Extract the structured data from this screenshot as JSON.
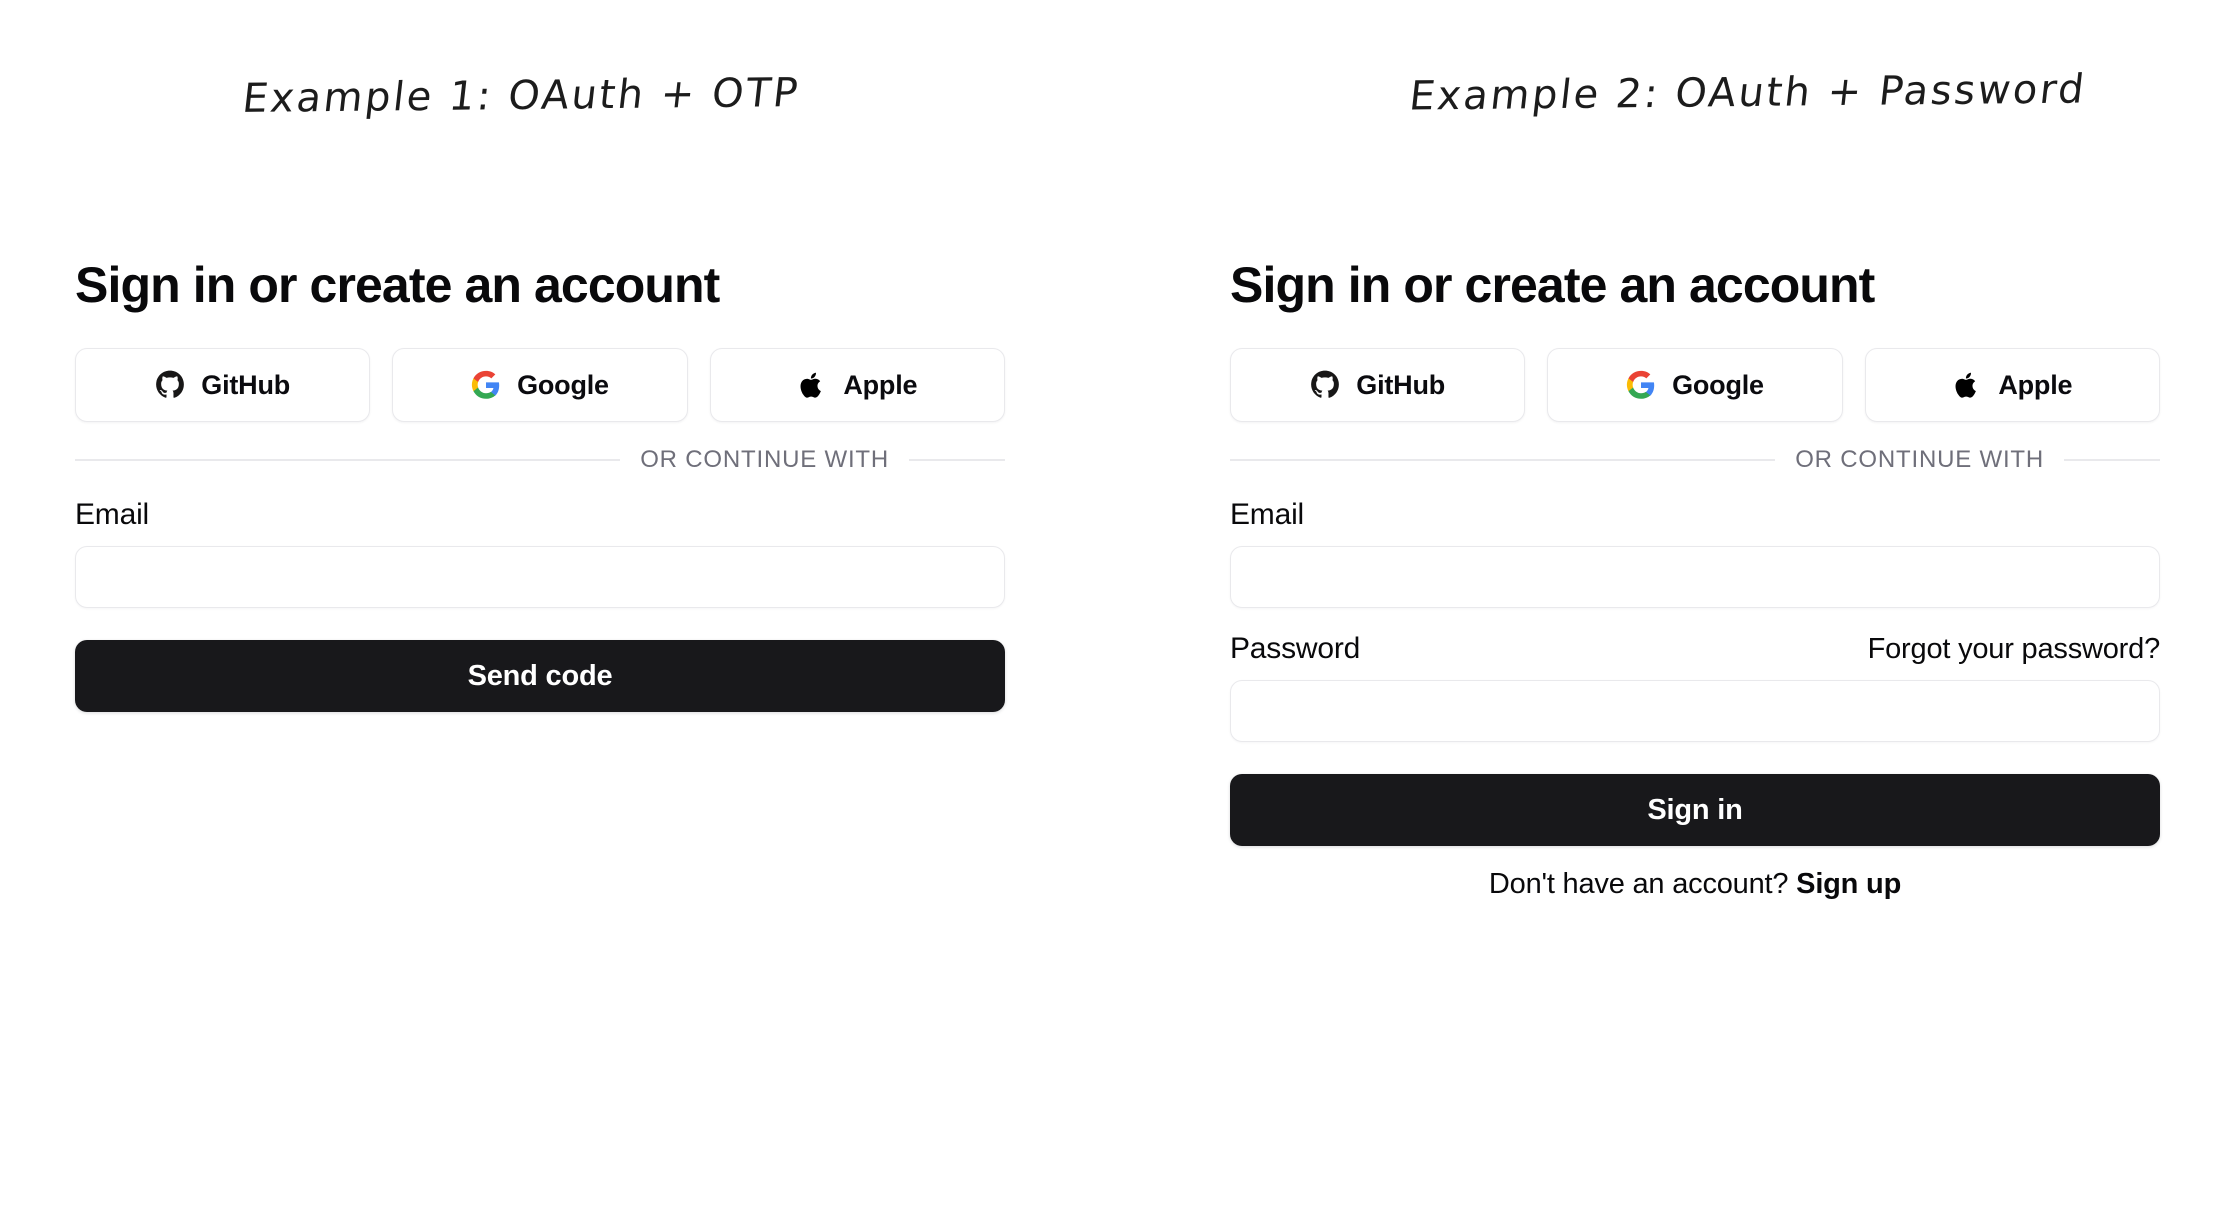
{
  "page": {
    "background": "#ffffff",
    "accent_dark": "#18181b",
    "border_color": "#e9e9ec",
    "muted_text": "#6f6f7a"
  },
  "examples": [
    {
      "caption": "Example 1: OAuth + OTP"
    },
    {
      "caption": "Example 2: OAuth + Password"
    }
  ],
  "left_panel": {
    "heading": "Sign in or create an account",
    "oauth": {
      "providers": [
        {
          "name": "github",
          "label": "GitHub",
          "icon": "github-icon"
        },
        {
          "name": "google",
          "label": "Google",
          "icon": "google-icon"
        },
        {
          "name": "apple",
          "label": "Apple",
          "icon": "apple-icon"
        }
      ]
    },
    "divider_text": "OR CONTINUE WITH",
    "email": {
      "label": "Email",
      "value": "",
      "placeholder": ""
    },
    "submit_label": "Send code"
  },
  "right_panel": {
    "heading": "Sign in or create an account",
    "oauth": {
      "providers": [
        {
          "name": "github",
          "label": "GitHub",
          "icon": "github-icon"
        },
        {
          "name": "google",
          "label": "Google",
          "icon": "google-icon"
        },
        {
          "name": "apple",
          "label": "Apple",
          "icon": "apple-icon"
        }
      ]
    },
    "divider_text": "OR CONTINUE WITH",
    "email": {
      "label": "Email",
      "value": "",
      "placeholder": ""
    },
    "password": {
      "label": "Password",
      "forgot_label": "Forgot your password?",
      "value": "",
      "placeholder": ""
    },
    "submit_label": "Sign in",
    "signup_prompt": "Don't have an account? ",
    "signup_link": "Sign up"
  },
  "brand_colors": {
    "github": "#181717",
    "apple": "#000000",
    "google_red": "#EA4335",
    "google_yellow": "#FBBC05",
    "google_green": "#34A853",
    "google_blue": "#4285F4"
  }
}
